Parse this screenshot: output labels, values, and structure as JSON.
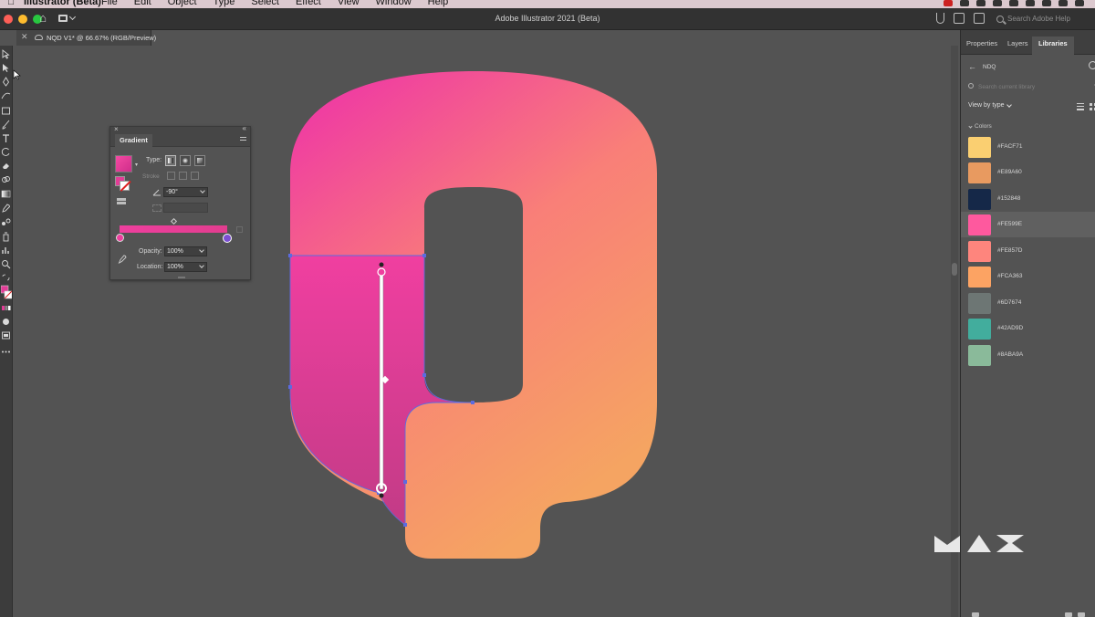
{
  "menubar": {
    "app_name": "Illustrator (Beta)",
    "menus": [
      "File",
      "Edit",
      "Object",
      "Type",
      "Select",
      "Effect",
      "View",
      "Window",
      "Help"
    ]
  },
  "titlebar": {
    "title": "Adobe Illustrator 2021 (Beta)",
    "search_placeholder": "Search Adobe Help"
  },
  "document_tab": {
    "name": "NQD V1* @ 66.67% (RGB/Preview)"
  },
  "gradient_panel": {
    "title": "Gradient",
    "type_label": "Type:",
    "stroke_label": "Stroke",
    "angle_value": "-90°",
    "opacity_label": "Opacity:",
    "opacity_value": "100%",
    "location_label": "Location:",
    "location_value": "100%",
    "gradient_start_color": "#EE3F9E",
    "gradient_end_color": "#E23D8F",
    "selected_stop_color": "#7B4FD2"
  },
  "right_panel": {
    "tabs": [
      "Properties",
      "Layers",
      "Libraries"
    ],
    "active_tab": "Libraries",
    "library_name": "NDQ",
    "search_placeholder": "Search current library",
    "view_by": "View by type",
    "section_title": "Colors",
    "colors": [
      {
        "hex": "#FACF71",
        "swatch": "#FACF71"
      },
      {
        "hex": "#E89A60",
        "swatch": "#E89A60"
      },
      {
        "hex": "#152848",
        "swatch": "#152848"
      },
      {
        "hex": "#FE599E",
        "swatch": "#FE599E",
        "selected": true
      },
      {
        "hex": "#FE857D",
        "swatch": "#FE857D"
      },
      {
        "hex": "#FCA363",
        "swatch": "#FCA363"
      },
      {
        "hex": "#6D7674",
        "swatch": "#6D7674"
      },
      {
        "hex": "#42AD9D",
        "swatch": "#42AD9D"
      },
      {
        "hex": "#8ABA9A",
        "swatch": "#8ABA9A"
      }
    ]
  },
  "artwork": {
    "top_left_color": "#F03FA0",
    "top_right_color": "#F97F78",
    "bottom_color": "#F5A462",
    "tail_dark_color": "#C23B86",
    "selection_color": "#5C6BE0"
  },
  "colors": {
    "ui_bg": "#535353",
    "panel_dark": "#323232",
    "menubar": "#DCC9CF"
  }
}
